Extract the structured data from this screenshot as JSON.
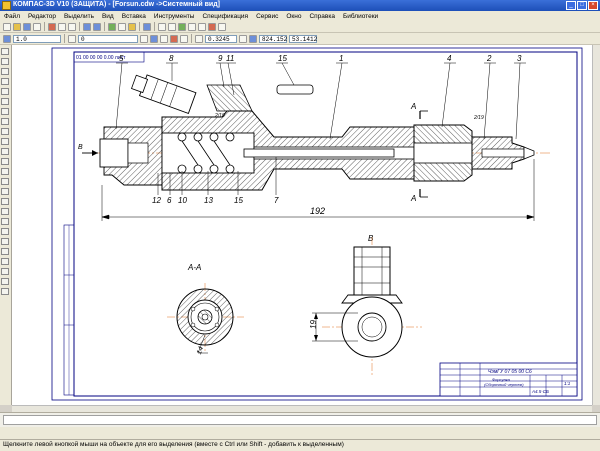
{
  "window": {
    "title": "КОМПАС-3D V10 (ЗАЩИТА) - [Forsun.cdw ->Системный вид]"
  },
  "menu": [
    "Файл",
    "Редактор",
    "Выделить",
    "Вид",
    "Вставка",
    "Инструменты",
    "Спецификация",
    "Сервис",
    "Окно",
    "Справка",
    "Библиотеки"
  ],
  "toolbar": {
    "scale": "1.0",
    "layer": "0",
    "zoom": "0.3245",
    "coord_x": "824.152",
    "coord_y": "53.1412"
  },
  "drawing": {
    "stamp_text": "01 00 00 00 0.00 лист",
    "dim_length": "192",
    "dim_19": "19",
    "section_label": "A-A",
    "view_b": "B",
    "arrow_b": "B",
    "cut_a_top": "A",
    "cut_a_bottom": "A",
    "dim_14": "14",
    "chamfer_1": "2/19",
    "chamfer_2": "2/19",
    "numbers_top": [
      "5",
      "8",
      "9",
      "11",
      "15",
      "1",
      "4",
      "2",
      "3"
    ],
    "numbers_bottom": [
      "12",
      "6",
      "10",
      "13",
      "15",
      "7"
    ],
    "title_block": {
      "designation": "ЧэмГУ 07 05 00 С6",
      "name_1": "Форсунка",
      "name_2": "(Сборочный чертеж)",
      "format": "A4.5-СБ",
      "sheet": "1:1"
    }
  },
  "status": {
    "hint": "Щелкните левой кнопкой мыши на объекте для его выделения (вместе с Ctrl или Shift - добавить к выделенным)"
  }
}
